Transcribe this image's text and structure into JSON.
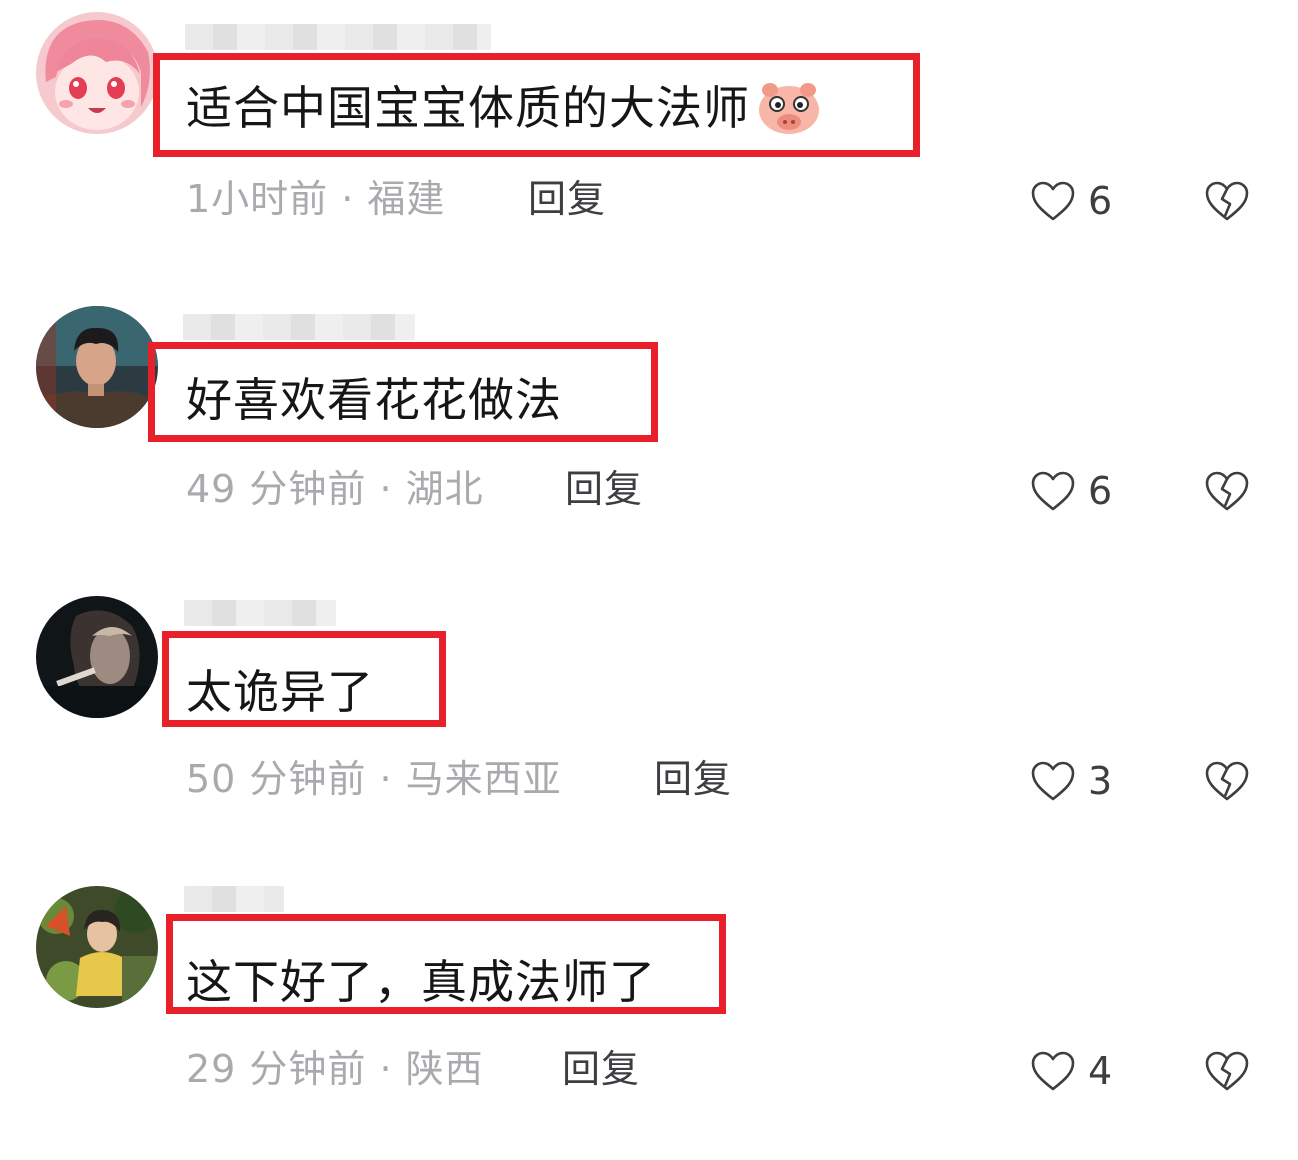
{
  "comments": [
    {
      "text": "适合中国宝宝体质的大法师",
      "emoji": "pig-face-emoji",
      "meta": "1小时前 · 福建",
      "reply_label": "回复",
      "likes": "6"
    },
    {
      "text": "好喜欢看花花做法",
      "meta": "49 分钟前 · 湖北",
      "reply_label": "回复",
      "likes": "6"
    },
    {
      "text": "太诡异了",
      "meta": "50 分钟前 · 马来西亚",
      "reply_label": "回复",
      "likes": "3"
    },
    {
      "text": "这下好了，真成法师了",
      "meta": "29 分钟前 · 陕西",
      "reply_label": "回复",
      "likes": "4"
    }
  ],
  "colors": {
    "highlight": "#e8202a",
    "text": "#161616",
    "meta": "#a9a9ae",
    "reply": "#3d3d42"
  },
  "icons": [
    "heart-outline-icon",
    "broken-heart-icon",
    "pig-face-emoji"
  ]
}
